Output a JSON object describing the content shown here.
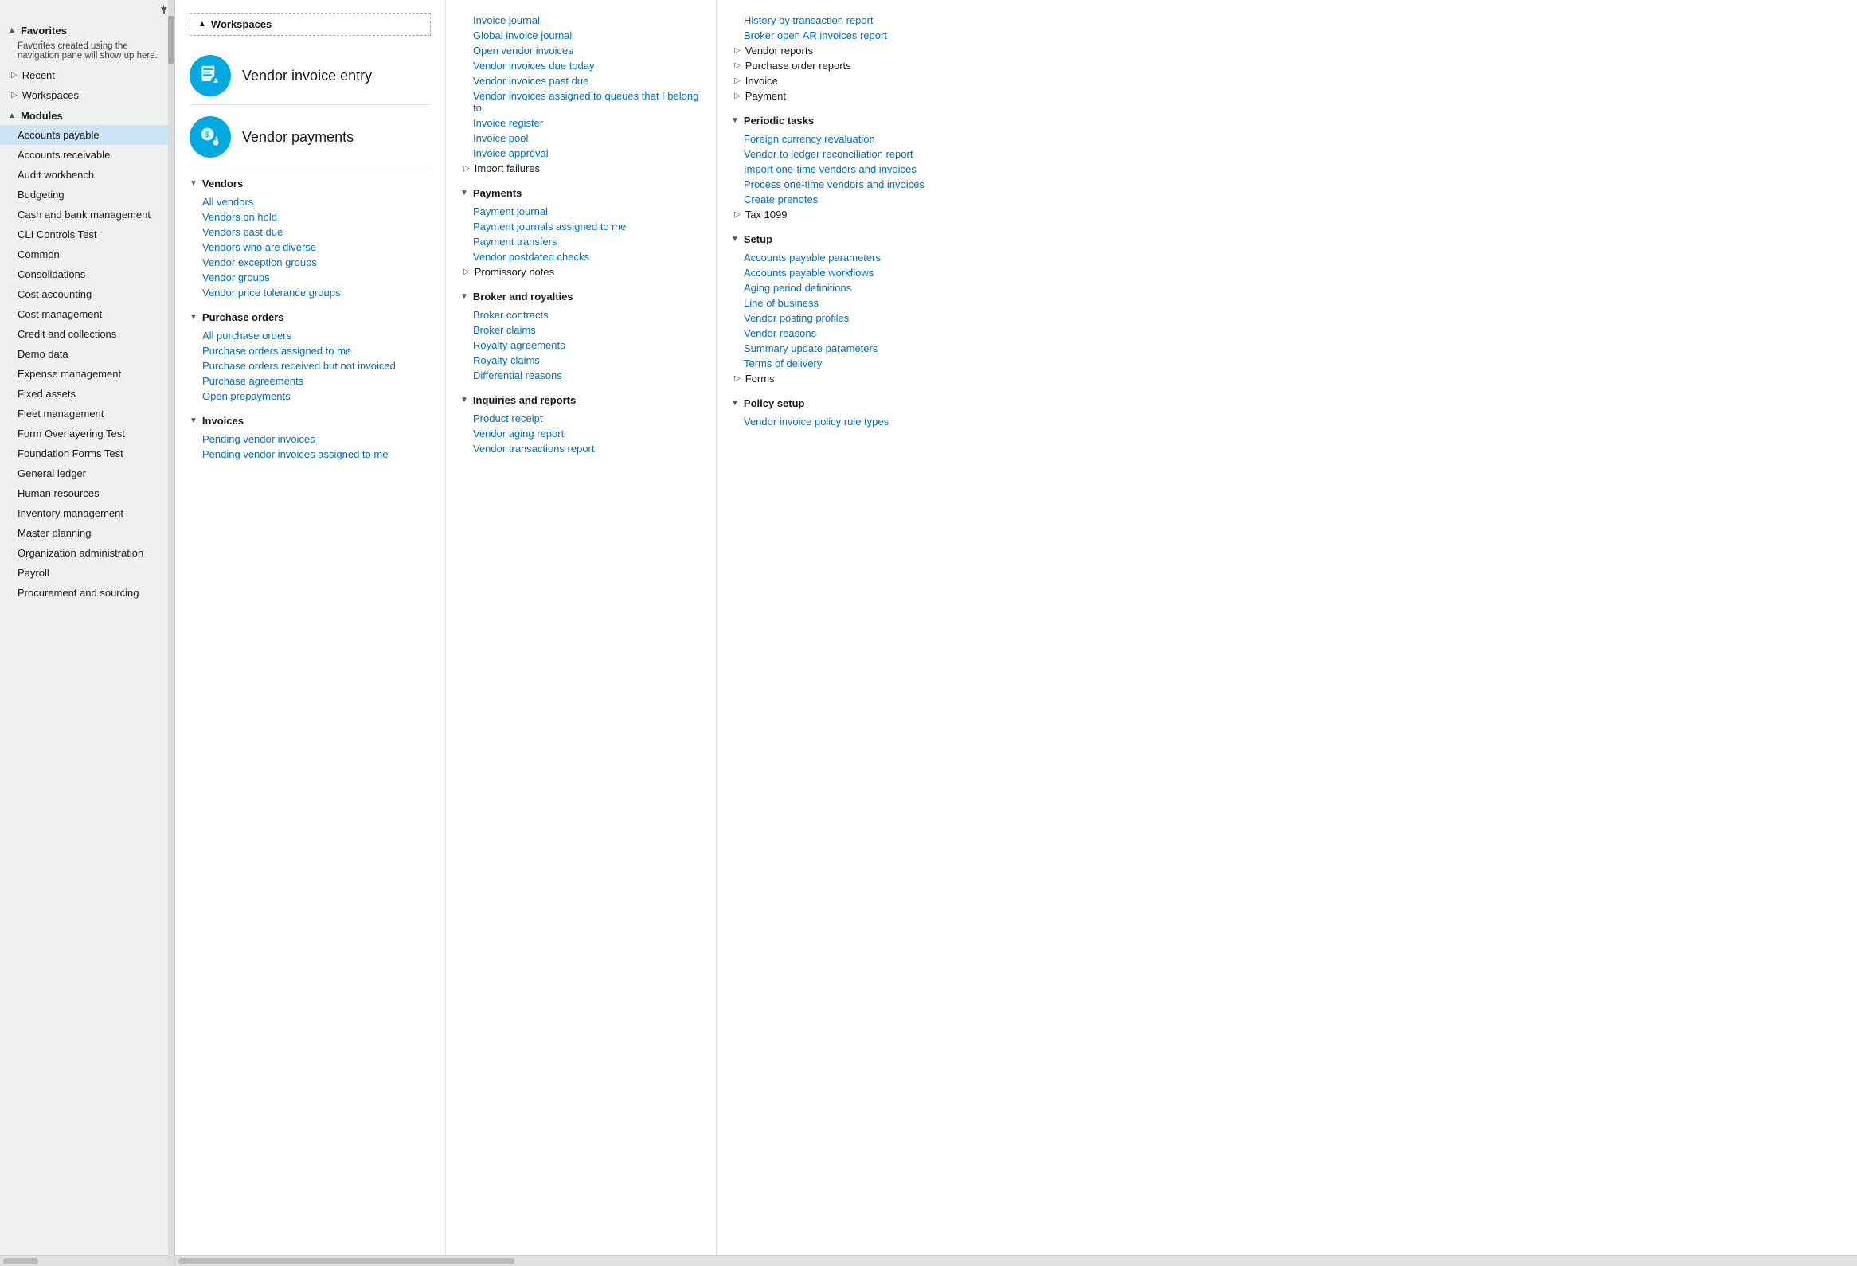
{
  "sidebar": {
    "pin_label": "pin",
    "sections": [
      {
        "id": "favorites",
        "label": "Favorites",
        "expanded": true,
        "arrow": "▲",
        "desc": "Favorites created using the navigation pane will show up here."
      },
      {
        "id": "recent",
        "label": "Recent",
        "expanded": false,
        "arrow": "▷"
      },
      {
        "id": "workspaces",
        "label": "Workspaces",
        "expanded": false,
        "arrow": "▷"
      },
      {
        "id": "modules",
        "label": "Modules",
        "expanded": true,
        "arrow": "▲"
      }
    ],
    "modules": [
      {
        "id": "accounts-payable",
        "label": "Accounts payable",
        "active": true
      },
      {
        "id": "accounts-receivable",
        "label": "Accounts receivable",
        "active": false
      },
      {
        "id": "audit-workbench",
        "label": "Audit workbench",
        "active": false
      },
      {
        "id": "budgeting",
        "label": "Budgeting",
        "active": false
      },
      {
        "id": "cash-bank",
        "label": "Cash and bank management",
        "active": false
      },
      {
        "id": "cli-controls",
        "label": "CLI Controls Test",
        "active": false
      },
      {
        "id": "common",
        "label": "Common",
        "active": false
      },
      {
        "id": "consolidations",
        "label": "Consolidations",
        "active": false
      },
      {
        "id": "cost-accounting",
        "label": "Cost accounting",
        "active": false
      },
      {
        "id": "cost-management",
        "label": "Cost management",
        "active": false
      },
      {
        "id": "credit-collections",
        "label": "Credit and collections",
        "active": false
      },
      {
        "id": "demo-data",
        "label": "Demo data",
        "active": false
      },
      {
        "id": "expense-management",
        "label": "Expense management",
        "active": false
      },
      {
        "id": "fixed-assets",
        "label": "Fixed assets",
        "active": false
      },
      {
        "id": "fleet-management",
        "label": "Fleet management",
        "active": false
      },
      {
        "id": "form-overlayering",
        "label": "Form Overlayering Test",
        "active": false
      },
      {
        "id": "foundation-forms",
        "label": "Foundation Forms Test",
        "active": false
      },
      {
        "id": "general-ledger",
        "label": "General ledger",
        "active": false
      },
      {
        "id": "human-resources",
        "label": "Human resources",
        "active": false
      },
      {
        "id": "inventory-management",
        "label": "Inventory management",
        "active": false
      },
      {
        "id": "master-planning",
        "label": "Master planning",
        "active": false
      },
      {
        "id": "org-admin",
        "label": "Organization administration",
        "active": false
      },
      {
        "id": "payroll",
        "label": "Payroll",
        "active": false
      },
      {
        "id": "procurement",
        "label": "Procurement and sourcing",
        "active": false
      }
    ]
  },
  "workspaces_section": {
    "label": "Workspaces",
    "arrow": "▲",
    "cards": [
      {
        "id": "vendor-invoice-entry",
        "title": "Vendor invoice entry",
        "icon": "invoice"
      },
      {
        "id": "vendor-payments",
        "title": "Vendor payments",
        "icon": "payments"
      }
    ]
  },
  "col_left": {
    "sections": [
      {
        "id": "vendors",
        "label": "Vendors",
        "arrow": "▼",
        "links": [
          "All vendors",
          "Vendors on hold",
          "Vendors past due",
          "Vendors who are diverse",
          "Vendor exception groups",
          "Vendor groups",
          "Vendor price tolerance groups"
        ]
      },
      {
        "id": "purchase-orders",
        "label": "Purchase orders",
        "arrow": "▼",
        "links": [
          "All purchase orders",
          "Purchase orders assigned to me",
          "Purchase orders received but not invoiced",
          "Purchase agreements",
          "Open prepayments"
        ]
      },
      {
        "id": "invoices",
        "label": "Invoices",
        "arrow": "▼",
        "links": [
          "Pending vendor invoices",
          "Pending vendor invoices assigned to me"
        ]
      }
    ]
  },
  "col_middle": {
    "sections": [
      {
        "id": "invoices-top",
        "label": "",
        "links": [
          "Invoice journal",
          "Global invoice journal",
          "Open vendor invoices",
          "Vendor invoices due today",
          "Vendor invoices past due",
          "Vendor invoices assigned to queues that I belong to",
          "Invoice register",
          "Invoice pool",
          "Invoice approval"
        ]
      },
      {
        "id": "import-failures",
        "label": "Import failures",
        "collapsed": true,
        "arrow": "▷"
      },
      {
        "id": "payments",
        "label": "Payments",
        "arrow": "▼",
        "links": [
          "Payment journal",
          "Payment journals assigned to me",
          "Payment transfers",
          "Vendor postdated checks"
        ]
      },
      {
        "id": "promissory-notes",
        "label": "Promissory notes",
        "collapsed": true,
        "arrow": "▷"
      },
      {
        "id": "broker-royalties",
        "label": "Broker and royalties",
        "arrow": "▼",
        "links": [
          "Broker contracts",
          "Broker claims",
          "Royalty agreements",
          "Royalty claims",
          "Differential reasons"
        ]
      },
      {
        "id": "inquiries-reports",
        "label": "Inquiries and reports",
        "arrow": "▼",
        "links": [
          "Product receipt",
          "Vendor aging report",
          "Vendor transactions report"
        ]
      }
    ]
  },
  "col_right": {
    "sections": [
      {
        "id": "reports-top",
        "label": "",
        "links": [
          "History by transaction report",
          "Broker open AR invoices report"
        ]
      },
      {
        "id": "vendor-reports",
        "label": "Vendor reports",
        "collapsed": true,
        "arrow": "▷"
      },
      {
        "id": "purchase-order-reports",
        "label": "Purchase order reports",
        "collapsed": true,
        "arrow": "▷"
      },
      {
        "id": "invoice-col",
        "label": "Invoice",
        "collapsed": true,
        "arrow": "▷"
      },
      {
        "id": "payment-col",
        "label": "Payment",
        "collapsed": true,
        "arrow": "▷"
      },
      {
        "id": "periodic-tasks",
        "label": "Periodic tasks",
        "arrow": "▼",
        "links": [
          "Foreign currency revaluation",
          "Vendor to ledger reconciliation report",
          "Import one-time vendors and invoices",
          "Process one-time vendors and invoices",
          "Create prenotes"
        ]
      },
      {
        "id": "tax-1099",
        "label": "Tax 1099",
        "collapsed": true,
        "arrow": "▷"
      },
      {
        "id": "setup",
        "label": "Setup",
        "arrow": "▼",
        "links": [
          "Accounts payable parameters",
          "Accounts payable workflows",
          "Aging period definitions",
          "Line of business",
          "Vendor posting profiles",
          "Vendor reasons",
          "Summary update parameters",
          "Terms of delivery"
        ]
      },
      {
        "id": "forms-col",
        "label": "Forms",
        "collapsed": true,
        "arrow": "▷"
      },
      {
        "id": "policy-setup",
        "label": "Policy setup",
        "arrow": "▼",
        "links": [
          "Vendor invoice policy rule types"
        ]
      }
    ]
  }
}
